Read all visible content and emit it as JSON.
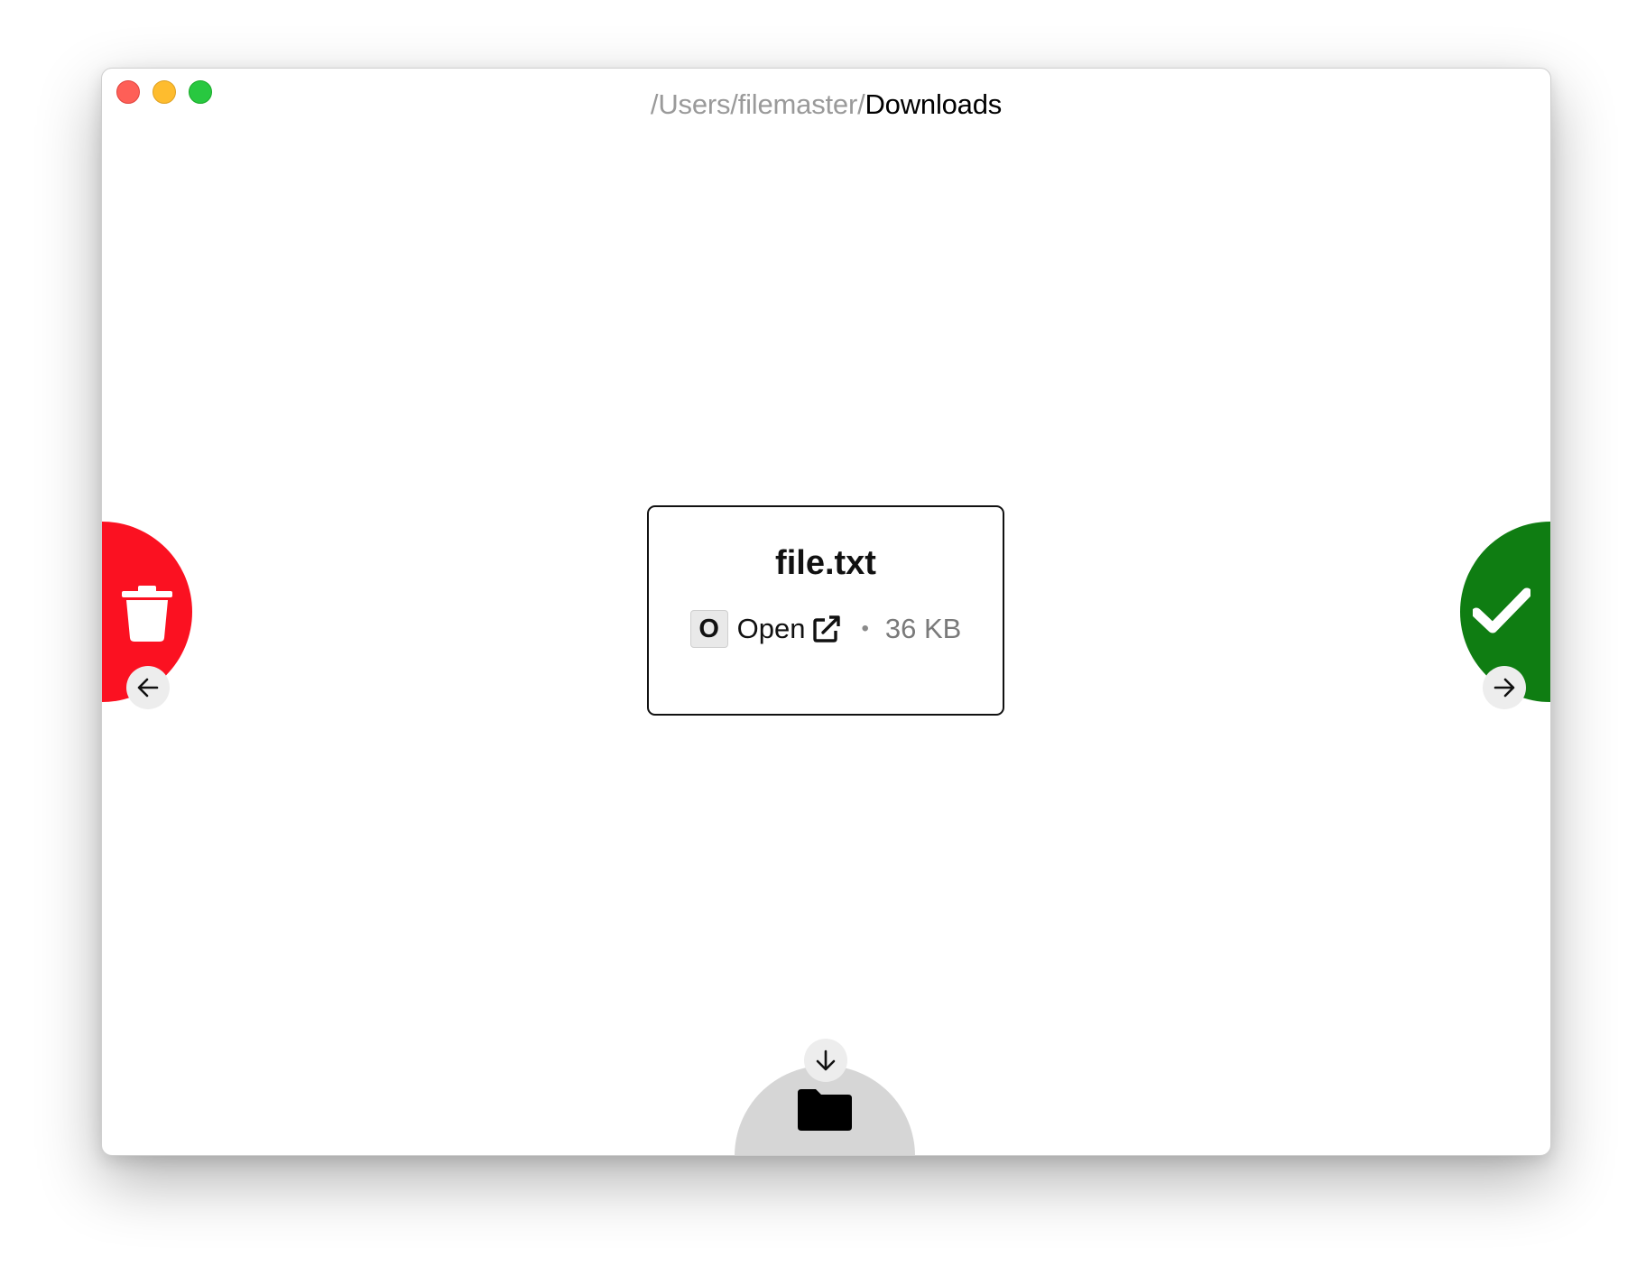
{
  "window": {
    "title_prefix": "/Users/filemaster/",
    "title_current": "Downloads"
  },
  "file": {
    "name": "file.txt",
    "shortcut_key": "O",
    "open_label": "Open",
    "separator": "•",
    "size": "36 KB"
  },
  "actions": {
    "left": {
      "icon": "trash-icon",
      "arrow": "arrow-left-icon",
      "color": "#fb1121"
    },
    "right": {
      "icon": "check-icon",
      "arrow": "arrow-right-icon",
      "color": "#0f7d12"
    },
    "bottom": {
      "icon": "folder-icon",
      "arrow": "arrow-down-icon",
      "color": "#d6d6d6"
    }
  }
}
